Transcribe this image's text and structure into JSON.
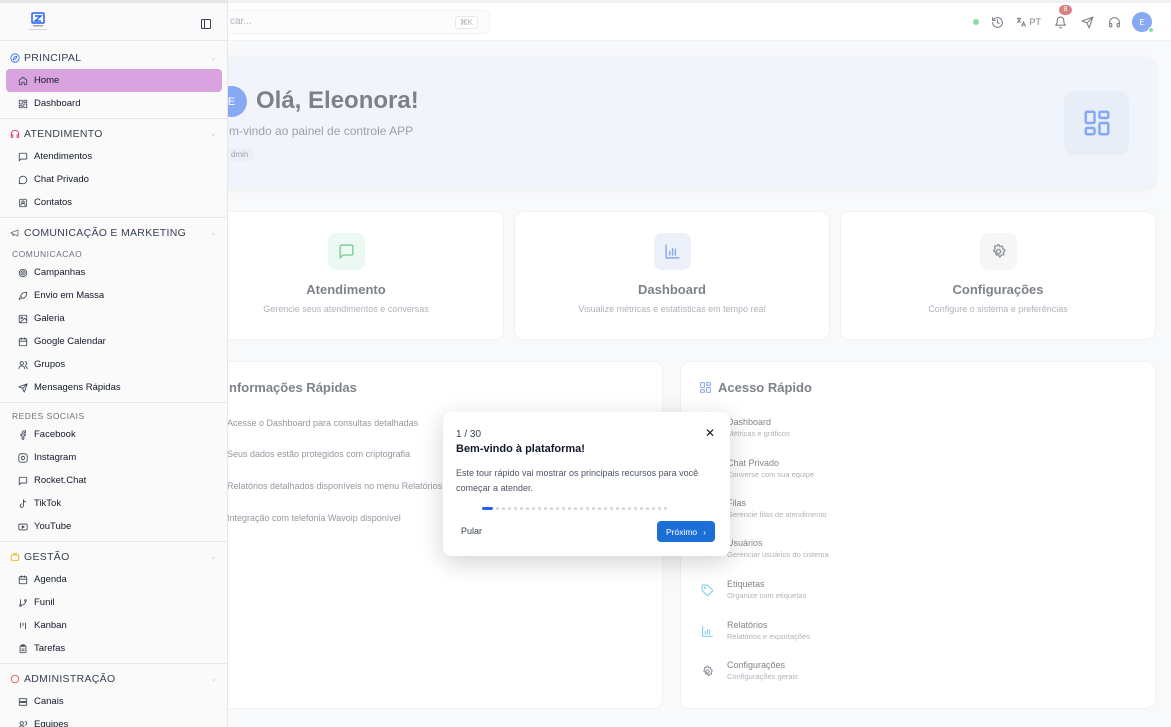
{
  "topbar": {
    "search_placeholder": "car...",
    "shortcut": "⌘K",
    "language": "PT",
    "notifications_count": "8",
    "user_initial": "E"
  },
  "hero": {
    "avatar_initial": "E",
    "greeting": "Olá, Eleonora!",
    "subtitle": "m-vindo ao painel de controle APP",
    "role": "dmin"
  },
  "cards": [
    {
      "title": "Atendimento",
      "desc": "Gerencie seus atendimentos e conversas",
      "icon": "chat-icon"
    },
    {
      "title": "Dashboard",
      "desc": "Visualize métricas e estatísticas em tempo real",
      "icon": "bar-chart-icon"
    },
    {
      "title": "Configurações",
      "desc": "Configure o sistema e preferências",
      "icon": "gear-icon"
    }
  ],
  "info": {
    "title": "nformações Rápidas",
    "items": [
      "Acesse o Dashboard para consultas detalhadas",
      "Seus dados estão protegidos com criptografia",
      "Relatórios detalhados disponíveis no menu Relatórios",
      "Integração com telefonia Wavoip disponível"
    ]
  },
  "quick_access": {
    "title": "Acesso Rápido",
    "items": [
      {
        "name": "Dashboard",
        "desc": "Métricas e gráficos"
      },
      {
        "name": "Chat Privado",
        "desc": "Converse com sua equipe"
      },
      {
        "name": "Filas",
        "desc": "Gerencie filas de atendimento"
      },
      {
        "name": "Usuários",
        "desc": "Gerenciar usuários do sistema"
      },
      {
        "name": "Etiquetas",
        "desc": "Organize com etiquetas"
      },
      {
        "name": "Relatórios",
        "desc": "Relatórios e exportações"
      },
      {
        "name": "Configurações",
        "desc": "Configurações gerais"
      }
    ]
  },
  "sidebar": {
    "sections": {
      "principal": "PRINCIPAL",
      "atendimento": "ATENDIMENTO",
      "comunicacao": "COMUNICAÇÃO E MARKETING",
      "comunicacao_sub": "COMUNICACAO",
      "redes_sub": "REDES SOCIAIS",
      "gestao": "GESTÃO",
      "admin": "ADMINISTRAÇÃO"
    },
    "items": {
      "home": "Home",
      "dashboard": "Dashboard",
      "atendimentos": "Atendimentos",
      "chat_privado": "Chat Privado",
      "contatos": "Contatos",
      "campanhas": "Campanhas",
      "envio_massa": "Envio em Massa",
      "galeria": "Galeria",
      "google_calendar": "Google Calendar",
      "grupos": "Grupos",
      "mensagens_rapidas": "Mensagens Rápidas",
      "facebook": "Facebook",
      "instagram": "Instagram",
      "rocketchat": "Rocket.Chat",
      "tiktok": "TikTok",
      "youtube": "YouTube",
      "agenda": "Agenda",
      "funil": "Funil",
      "kanban": "Kanban",
      "tarefas": "Tarefas",
      "canais": "Canais",
      "equipes": "Equipes"
    }
  },
  "tour": {
    "step": "1 / 30",
    "title": "Bem-vindo à plataforma!",
    "body": "Este tour rápido vai mostrar os principais recursos para você começar a atender.",
    "skip": "Pular",
    "next": "Próximo",
    "current_step": 1,
    "total_steps": 30
  },
  "colors": {
    "primary": "#2563eb",
    "active_nav": "#d8a3de",
    "online": "#22c55e"
  }
}
